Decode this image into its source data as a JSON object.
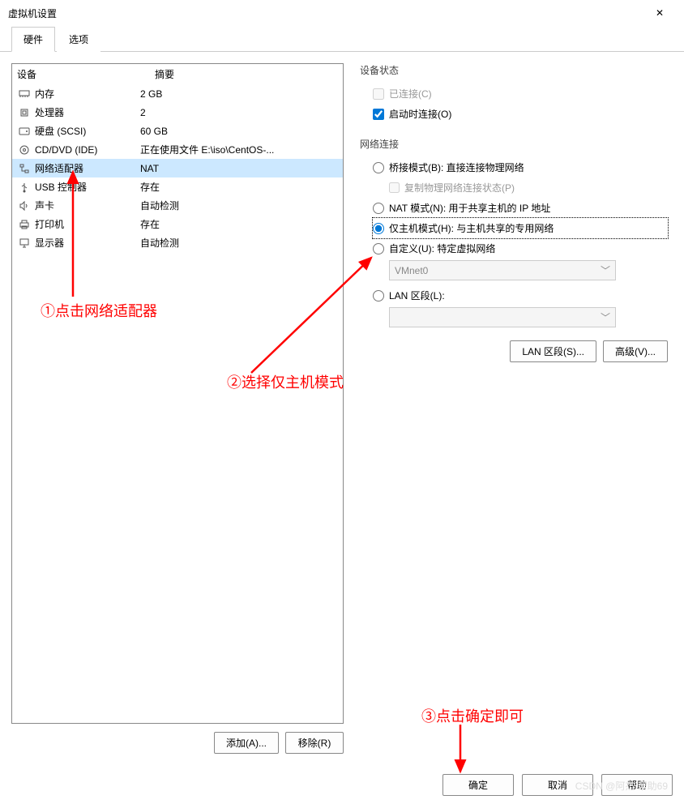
{
  "window": {
    "title": "虚拟机设置"
  },
  "tabs": {
    "hardware": "硬件",
    "options": "选项"
  },
  "deviceList": {
    "header": {
      "device": "设备",
      "summary": "摘要"
    },
    "rows": [
      {
        "name": "内存",
        "summary": "2 GB",
        "icon": "memory"
      },
      {
        "name": "处理器",
        "summary": "2",
        "icon": "cpu"
      },
      {
        "name": "硬盘 (SCSI)",
        "summary": "60 GB",
        "icon": "disk"
      },
      {
        "name": "CD/DVD (IDE)",
        "summary": "正在使用文件 E:\\iso\\CentOS-...",
        "icon": "cd"
      },
      {
        "name": "网络适配器",
        "summary": "NAT",
        "icon": "network",
        "selected": true
      },
      {
        "name": "USB 控制器",
        "summary": "存在",
        "icon": "usb"
      },
      {
        "name": "声卡",
        "summary": "自动检测",
        "icon": "sound"
      },
      {
        "name": "打印机",
        "summary": "存在",
        "icon": "printer"
      },
      {
        "name": "显示器",
        "summary": "自动检测",
        "icon": "display"
      }
    ]
  },
  "leftButtons": {
    "add": "添加(A)...",
    "remove": "移除(R)"
  },
  "rightPanel": {
    "deviceStatus": {
      "title": "设备状态",
      "connected": "已连接(C)",
      "connectAtPowerOn": "启动时连接(O)"
    },
    "networkConnection": {
      "title": "网络连接",
      "bridged": "桥接模式(B): 直接连接物理网络",
      "replicate": "复制物理网络连接状态(P)",
      "nat": "NAT 模式(N): 用于共享主机的 IP 地址",
      "hostOnly": "仅主机模式(H): 与主机共享的专用网络",
      "custom": "自定义(U): 特定虚拟网络",
      "customValue": "VMnet0",
      "lanSegment": "LAN 区段(L):",
      "lanSegmentValue": ""
    },
    "buttons": {
      "lanSegments": "LAN 区段(S)...",
      "advanced": "高级(V)..."
    }
  },
  "footer": {
    "ok": "确定",
    "cancel": "取消",
    "help": "帮助"
  },
  "annotations": {
    "step1": "①点击网络适配器",
    "step2": "②选择仅主机模式",
    "step3": "③点击确定即可"
  },
  "watermark": "CSDN @阿杰 帮助69"
}
